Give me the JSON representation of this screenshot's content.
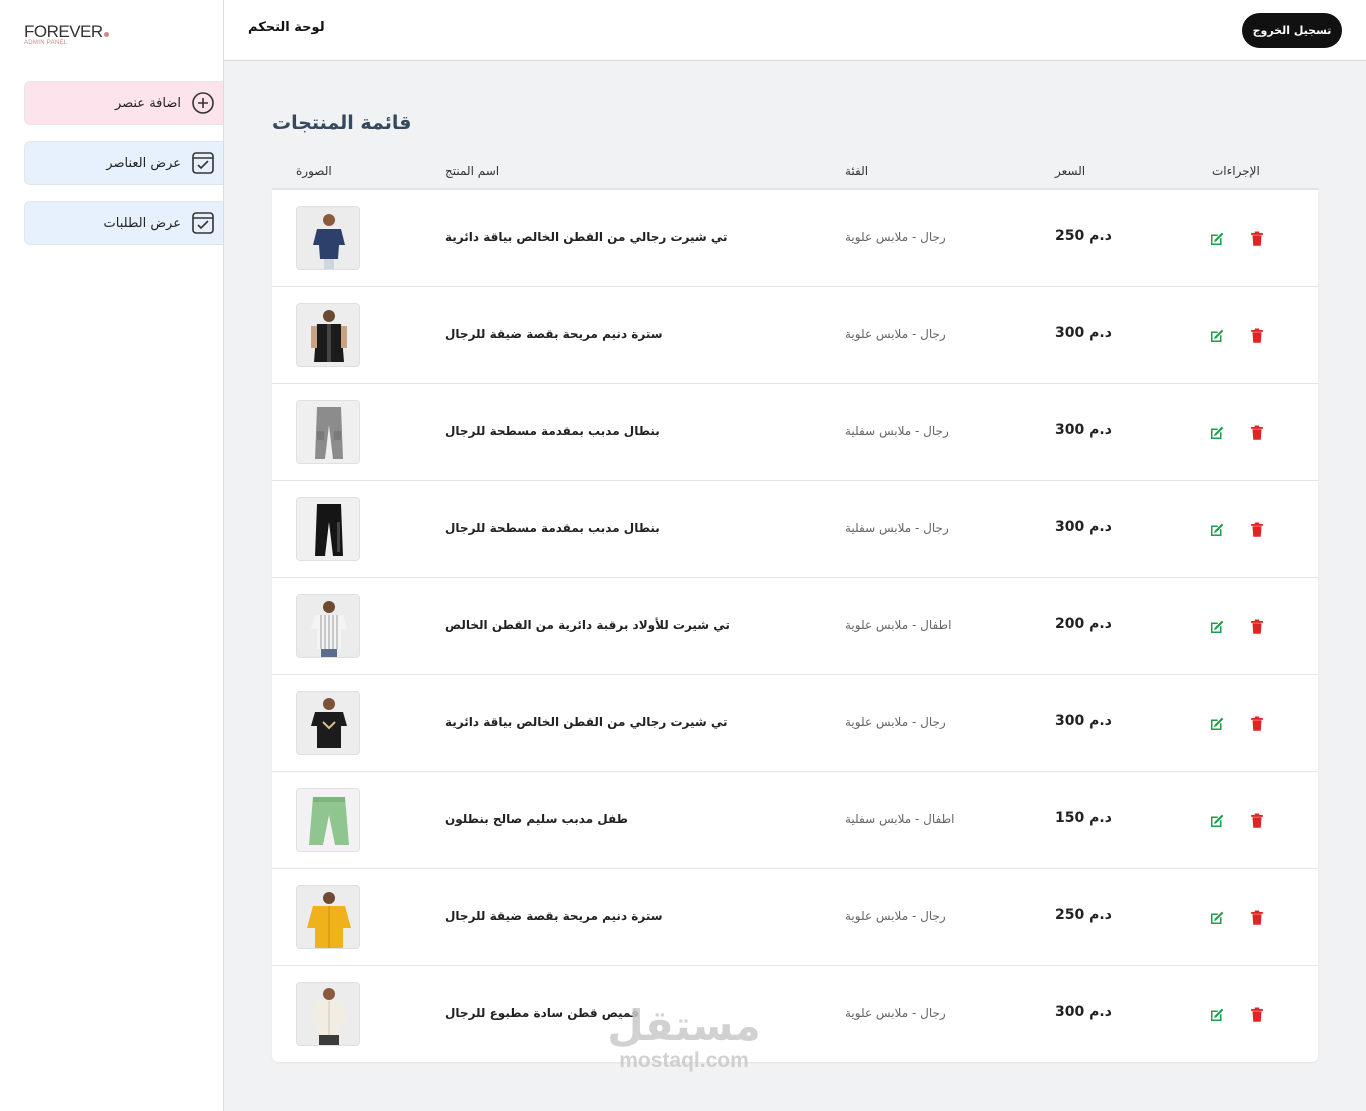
{
  "brand": {
    "name": "FOREVER",
    "subtitle": "ADMIN PANEL"
  },
  "sidebar": {
    "items": [
      {
        "label": "اضافة عنصر",
        "icon": "plus-circle-icon"
      },
      {
        "label": "عرض العناصر",
        "icon": "checkbox-icon"
      },
      {
        "label": "عرض الطلبات",
        "icon": "checkbox-icon"
      }
    ]
  },
  "header": {
    "title": "لوحة التحكم",
    "logout_label": "تسجيل الخروج"
  },
  "main": {
    "title": "قائمة المنتجات",
    "columns": {
      "image": "الصورة",
      "name": "اسم المنتج",
      "category": "الفئة",
      "price": "السعر",
      "actions": "الإجراءات"
    },
    "rows": [
      {
        "name": "تي شيرت رجالي من القطن الخالص بياقة دائرية",
        "category": "رجال - ملابس علوية",
        "price": "250 د.م",
        "image": "navy-shirt"
      },
      {
        "name": "سترة دنيم مريحة بقصة ضيقة للرجال",
        "category": "رجال - ملابس علوية",
        "price": "300 د.م",
        "image": "black-vest"
      },
      {
        "name": "بنطال مدبب بمقدمة مسطحة للرجال",
        "category": "رجال - ملابس سفلية",
        "price": "300 د.م",
        "image": "grey-cargo-pants"
      },
      {
        "name": "بنطال مدبب بمقدمة مسطحة للرجال",
        "category": "رجال - ملابس سفلية",
        "price": "300 د.م",
        "image": "black-joggers"
      },
      {
        "name": "تي شيرت للأولاد برقبة دائرية من القطن الخالص",
        "category": "اطفال - ملابس علوية",
        "price": "200 د.م",
        "image": "striped-kids-shirt"
      },
      {
        "name": "تي شيرت رجالي من القطن الخالص بياقة دائرية",
        "category": "رجال - ملابس علوية",
        "price": "300 د.م",
        "image": "black-printed-tshirt"
      },
      {
        "name": "طفل مدبب سليم صالح بنطلون",
        "category": "اطفال - ملابس سفلية",
        "price": "150 د.م",
        "image": "green-kids-pants"
      },
      {
        "name": "سترة دنيم مريحة بقصة ضيقة للرجال",
        "category": "رجال - ملابس علوية",
        "price": "250 د.م",
        "image": "mustard-shirt"
      },
      {
        "name": "قميص قطن سادة مطبوع للرجال",
        "category": "رجال - ملابس علوية",
        "price": "300 د.م",
        "image": "white-shirt"
      }
    ]
  },
  "watermark": {
    "arabic": "مستقل",
    "latin": "mostaql.com"
  },
  "colors": {
    "edit": "#1e9e4a",
    "delete": "#e02424",
    "add_bg": "#fde4ec",
    "nav_bg": "#e7f1fd",
    "title": "#34495e"
  }
}
